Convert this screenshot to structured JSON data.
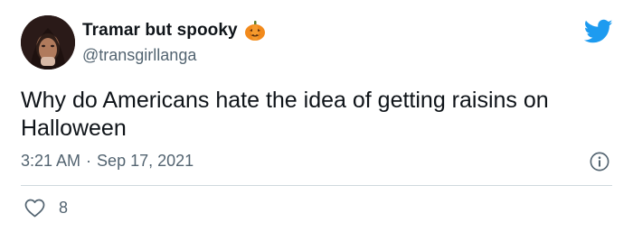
{
  "user": {
    "display_name": "Tramar but spooky",
    "handle": "@transgirllanga",
    "avatar_icon": "profile-photo",
    "name_emoji_icon": "jack-o-lantern-icon"
  },
  "tweet": {
    "text": "Why do Americans hate the idea of getting raisins on Halloween",
    "time": "3:21 AM",
    "separator": "·",
    "date": "Sep 17, 2021"
  },
  "stats": {
    "likes": "8"
  },
  "colors": {
    "brand": "#1d9bf0",
    "text": "#0f1419",
    "secondary": "#536471",
    "divider": "#cfd9de"
  }
}
